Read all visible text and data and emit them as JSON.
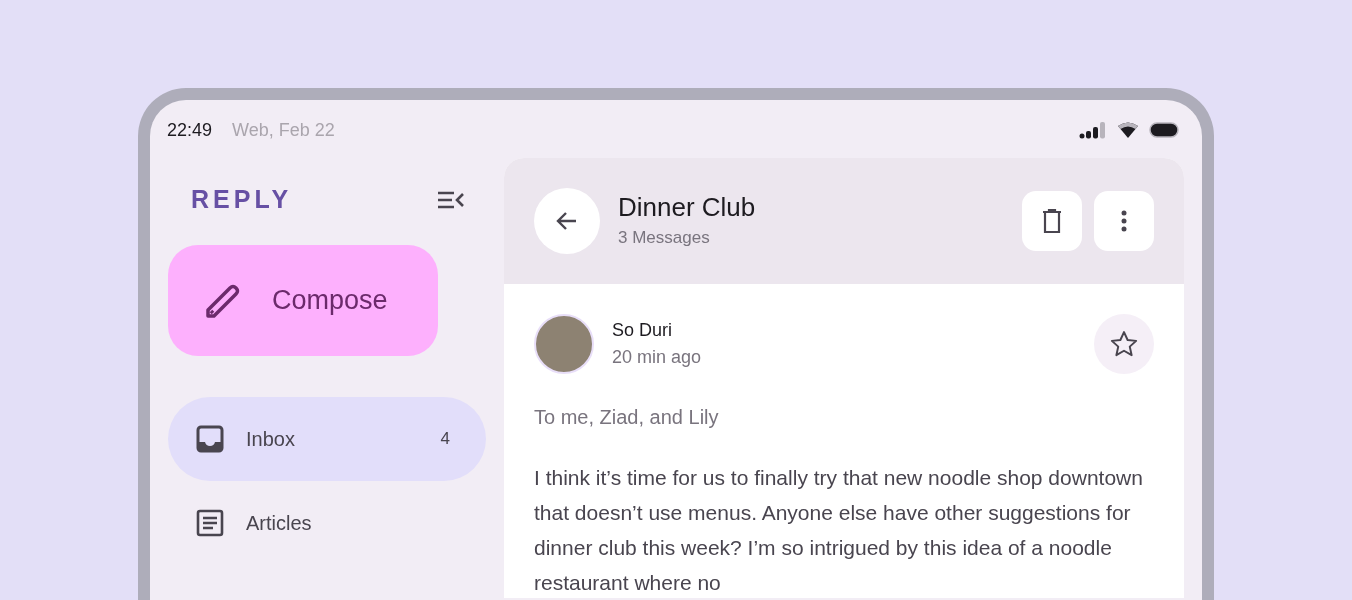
{
  "status_bar": {
    "time": "22:49",
    "date": "Web, Feb 22"
  },
  "sidebar": {
    "logo": "REPLY",
    "compose": "Compose",
    "items": [
      {
        "kind": "inbox",
        "label": "Inbox",
        "count": "4",
        "selected": true
      },
      {
        "kind": "articles",
        "label": "Articles",
        "selected": false
      }
    ]
  },
  "thread": {
    "title": "Dinner Club",
    "subtitle": "3 Messages"
  },
  "message": {
    "sender": "So Duri",
    "time": "20 min ago",
    "starred": false,
    "recipients": "To me, Ziad, and Lily",
    "body": "I think it’s time for us to finally try that new noodle shop downtown that doesn’t use menus. Anyone else have other suggestions for dinner club this week? I’m so intrigued by this idea of a noodle restaurant where no"
  }
}
